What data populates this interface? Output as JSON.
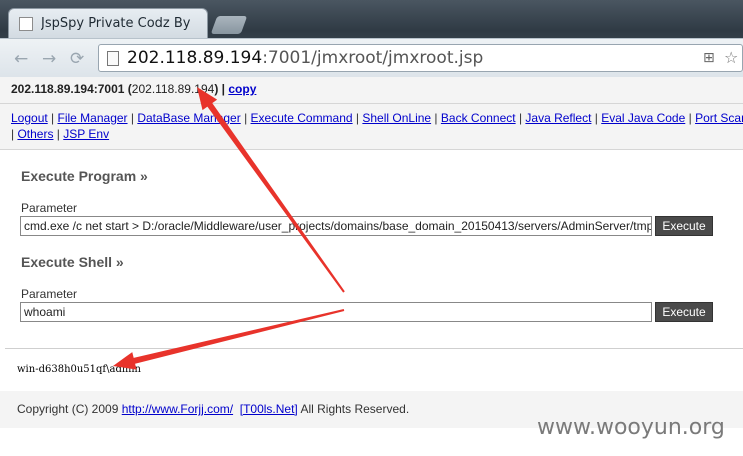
{
  "browser": {
    "tab_title": "JspSpy Private Codz By",
    "url_host": "202.118.89.194",
    "url_rest": ":7001/jmxroot/jmxroot.jsp",
    "back_glyph": "←",
    "forward_glyph": "→",
    "reload_glyph": "⟳",
    "translate_glyph": "⊞",
    "star_glyph": "☆"
  },
  "info": {
    "host_port": "202.118.89.194:7001",
    "open_paren": " (",
    "ip": "202.118.89.194",
    "close_sep": ") | ",
    "copy_link": "copy"
  },
  "nav": {
    "row1": [
      "Logout",
      "File Manager",
      "DataBase Manager",
      "Execute Command",
      "Shell OnLine",
      "Back Connect",
      "Java Reflect",
      "Eval Java Code",
      "Port Scan"
    ],
    "row2": [
      "Others",
      "JSP Env"
    ],
    "separator": " | "
  },
  "execute_program": {
    "title": "Execute Program »",
    "param_label": "Parameter",
    "value": "cmd.exe /c net start > D:/oracle/Middleware/user_projects/domains/base_domain_20150413/servers/AdminServer/tmp/",
    "button": "Execute"
  },
  "execute_shell": {
    "title": "Execute Shell »",
    "param_label": "Parameter",
    "value": "whoami",
    "button": "Execute"
  },
  "output": "win-d638h0u51qf\\admin",
  "footer": {
    "copyright": "Copyright (C) 2009 ",
    "link1": "http://www.Forjj.com/",
    "space": "  ",
    "link2": "[T00ls.Net]",
    "rights": " All Rights Reserved."
  },
  "watermark": "www.wooyun.org",
  "colors": {
    "arrow": "#e8332b",
    "link": "#0000cc",
    "button_bg": "#4a4a4a"
  }
}
